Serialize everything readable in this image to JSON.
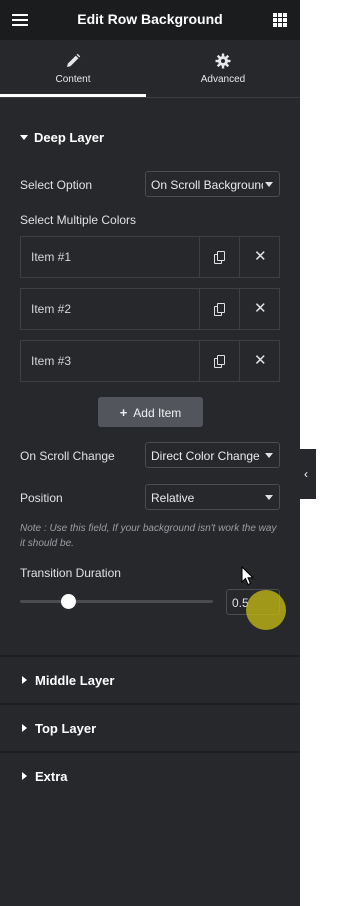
{
  "topbar": {
    "title": "Edit Row Background",
    "menu_icon": "hamburger-icon",
    "apps_icon": "grid-icon"
  },
  "tabs": [
    {
      "label": "Content",
      "icon": "pencil-icon",
      "active": true
    },
    {
      "label": "Advanced",
      "icon": "gear-icon",
      "active": false
    }
  ],
  "deep_layer": {
    "title": "Deep Layer",
    "select_option_label": "Select Option",
    "select_option_value": "On Scroll Background",
    "multiple_colors_label": "Select Multiple Colors",
    "items": [
      {
        "label": "Item #1"
      },
      {
        "label": "Item #2"
      },
      {
        "label": "Item #3"
      }
    ],
    "add_item_label": "Add Item",
    "scroll_change_label": "On Scroll Change",
    "scroll_change_value": "Direct Color Change",
    "position_label": "Position",
    "position_value": "Relative",
    "note": "Note : Use this field, If your background isn't work the way it should be.",
    "transition_label": "Transition Duration",
    "transition_value": "0.5",
    "transition_level": 0.25
  },
  "sections": [
    {
      "title": "Middle Layer"
    },
    {
      "title": "Top Layer"
    },
    {
      "title": "Extra"
    }
  ],
  "colors": {
    "panel_bg": "#26282b",
    "topbar_bg": "#1b1c1e",
    "button_bg": "#52565c",
    "highlight": "#c8be14"
  }
}
